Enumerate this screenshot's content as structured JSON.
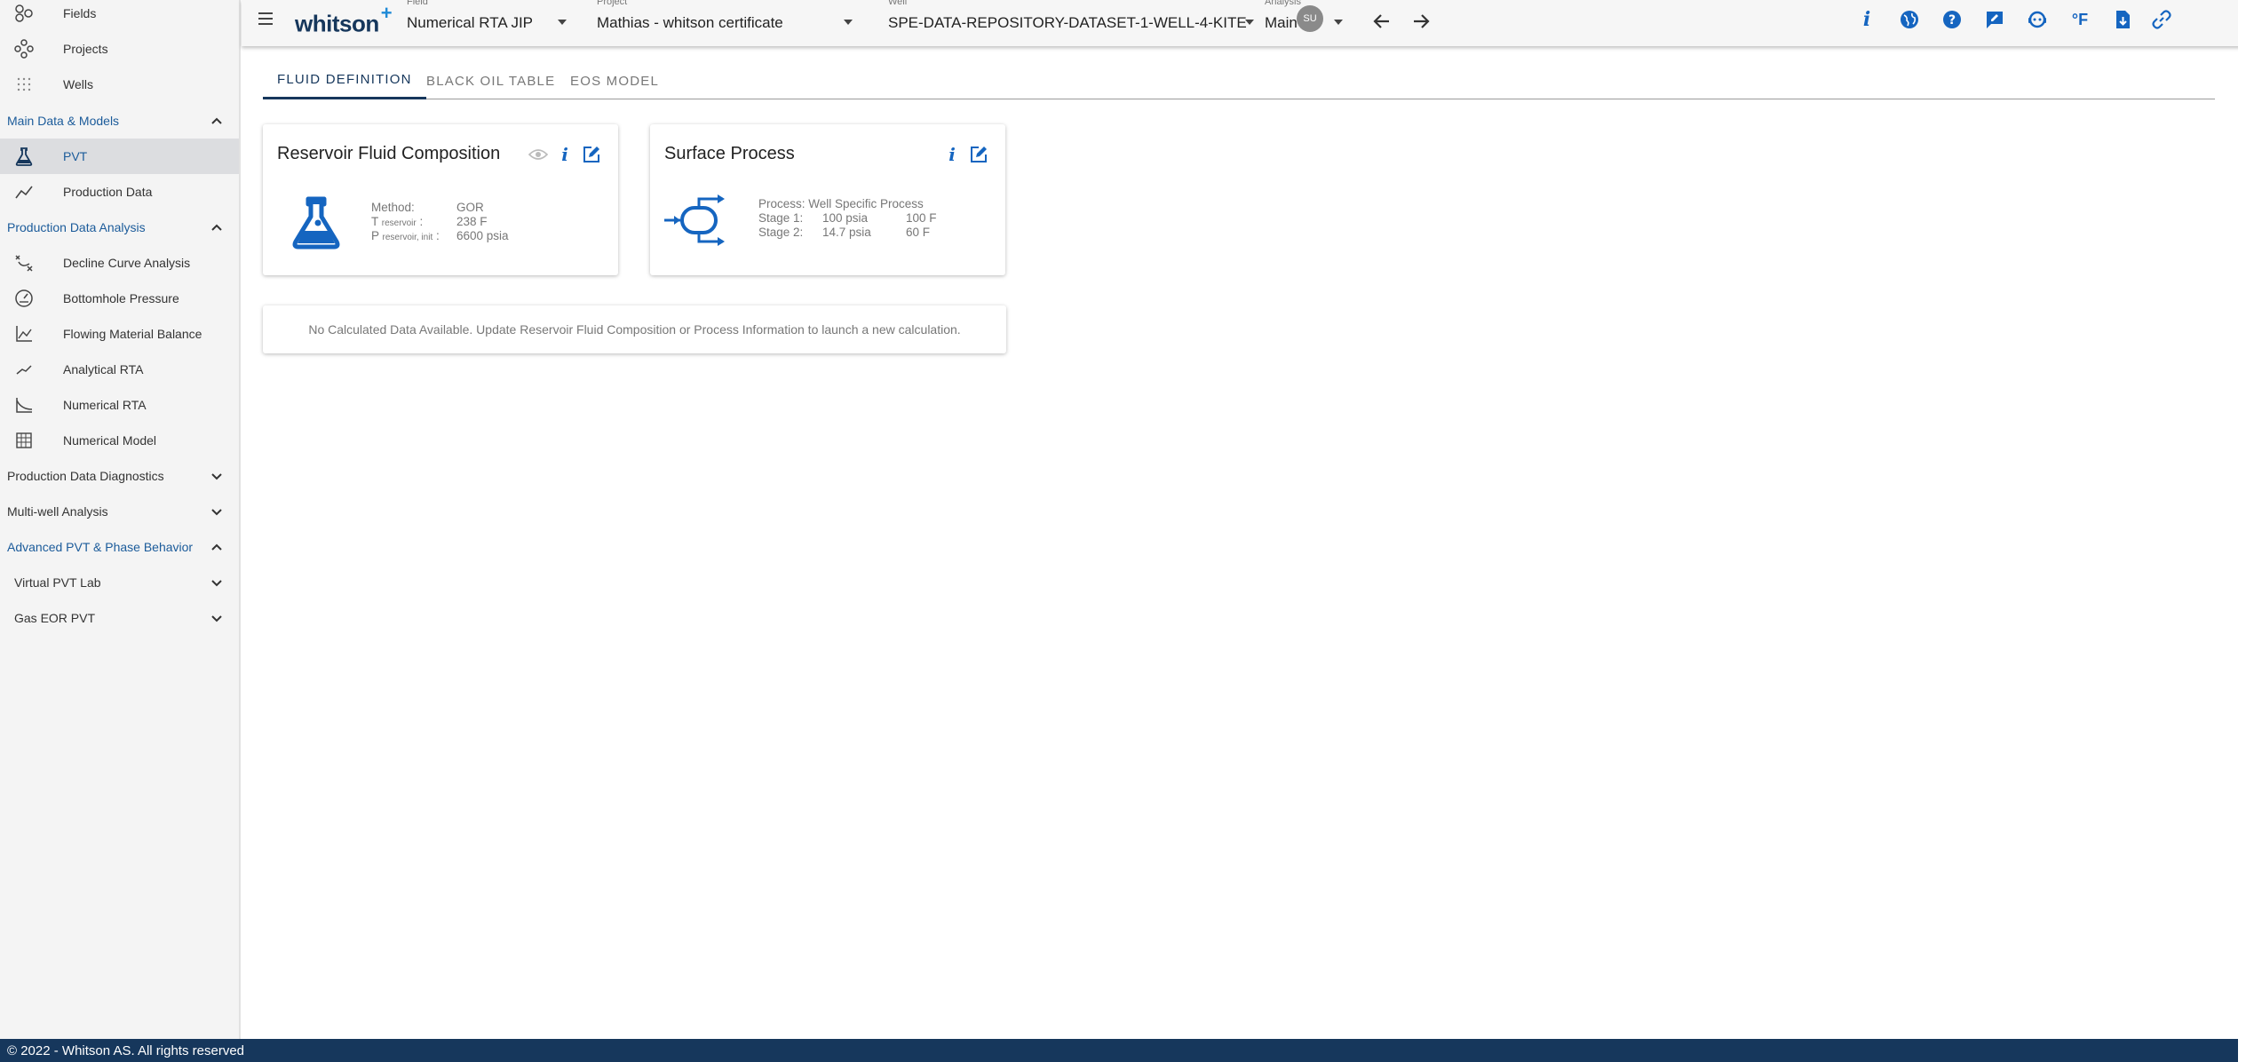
{
  "sidebar": {
    "items_top": [
      {
        "label": "Fields",
        "icon": "fields-icon"
      },
      {
        "label": "Projects",
        "icon": "projects-icon"
      },
      {
        "label": "Wells",
        "icon": "wells-icon"
      }
    ],
    "section_main": "Main Data & Models",
    "main_items": [
      {
        "label": "PVT",
        "icon": "flask-icon"
      },
      {
        "label": "Production Data",
        "icon": "trend-line-icon"
      }
    ],
    "section_pda": "Production Data Analysis",
    "pda_items": [
      {
        "label": "Decline Curve Analysis",
        "icon": "decline-icon"
      },
      {
        "label": "Bottomhole Pressure",
        "icon": "gauge-icon"
      },
      {
        "label": "Flowing Material Balance",
        "icon": "chart-icon"
      },
      {
        "label": "Analytical RTA",
        "icon": "trend-line-icon"
      },
      {
        "label": "Numerical RTA",
        "icon": "numerical-rta-icon"
      },
      {
        "label": "Numerical Model",
        "icon": "grid-icon"
      }
    ],
    "section_diag": "Production Data Diagnostics",
    "section_multi": "Multi-well Analysis",
    "section_adv": "Advanced PVT & Phase Behavior",
    "sub_virtual": "Virtual PVT Lab",
    "sub_gas": "Gas EOR PVT"
  },
  "topbar": {
    "brand": "whitson",
    "brand_sup": "+",
    "field_label": "Field",
    "field_value": "Numerical RTA JIP",
    "project_label": "Project",
    "project_value": "Mathias - whitson certificate",
    "well_label": "Well",
    "well_value": "SPE-DATA-REPOSITORY-DATASET-1-WELL-4-KITE",
    "analysis_label": "Analysis",
    "analysis_value": "Main",
    "avatar": "SU",
    "units_label": "°F"
  },
  "tabs": [
    "FLUID DEFINITION",
    "BLACK OIL TABLE",
    "EOS MODEL"
  ],
  "reservoir_card": {
    "title": "Reservoir Fluid Composition",
    "method_label": "Method:",
    "method_value": "GOR",
    "t_label": "T",
    "t_sub": "reservoir",
    "t_colon": ":",
    "t_value": "238 F",
    "p_label": "P",
    "p_sub": "reservoir, init",
    "p_colon": ":",
    "p_value": "6600 psia"
  },
  "surface_card": {
    "title": "Surface Process",
    "process_line": "Process: Well Specific Process",
    "stage1_label": "Stage 1:",
    "stage1_p": "100 psia",
    "stage1_t": "100 F",
    "stage2_label": "Stage 2:",
    "stage2_p": "14.7 psia",
    "stage2_t": "60 F"
  },
  "notice": "No Calculated Data Available. Update Reservoir Fluid Composition or Process Information to launch a new calculation.",
  "footer": "© 2022 - Whitson AS. All rights reserved",
  "colors": {
    "accent": "#1b5b9a",
    "brand": "#16375c",
    "icon_blue": "#1565c0"
  }
}
